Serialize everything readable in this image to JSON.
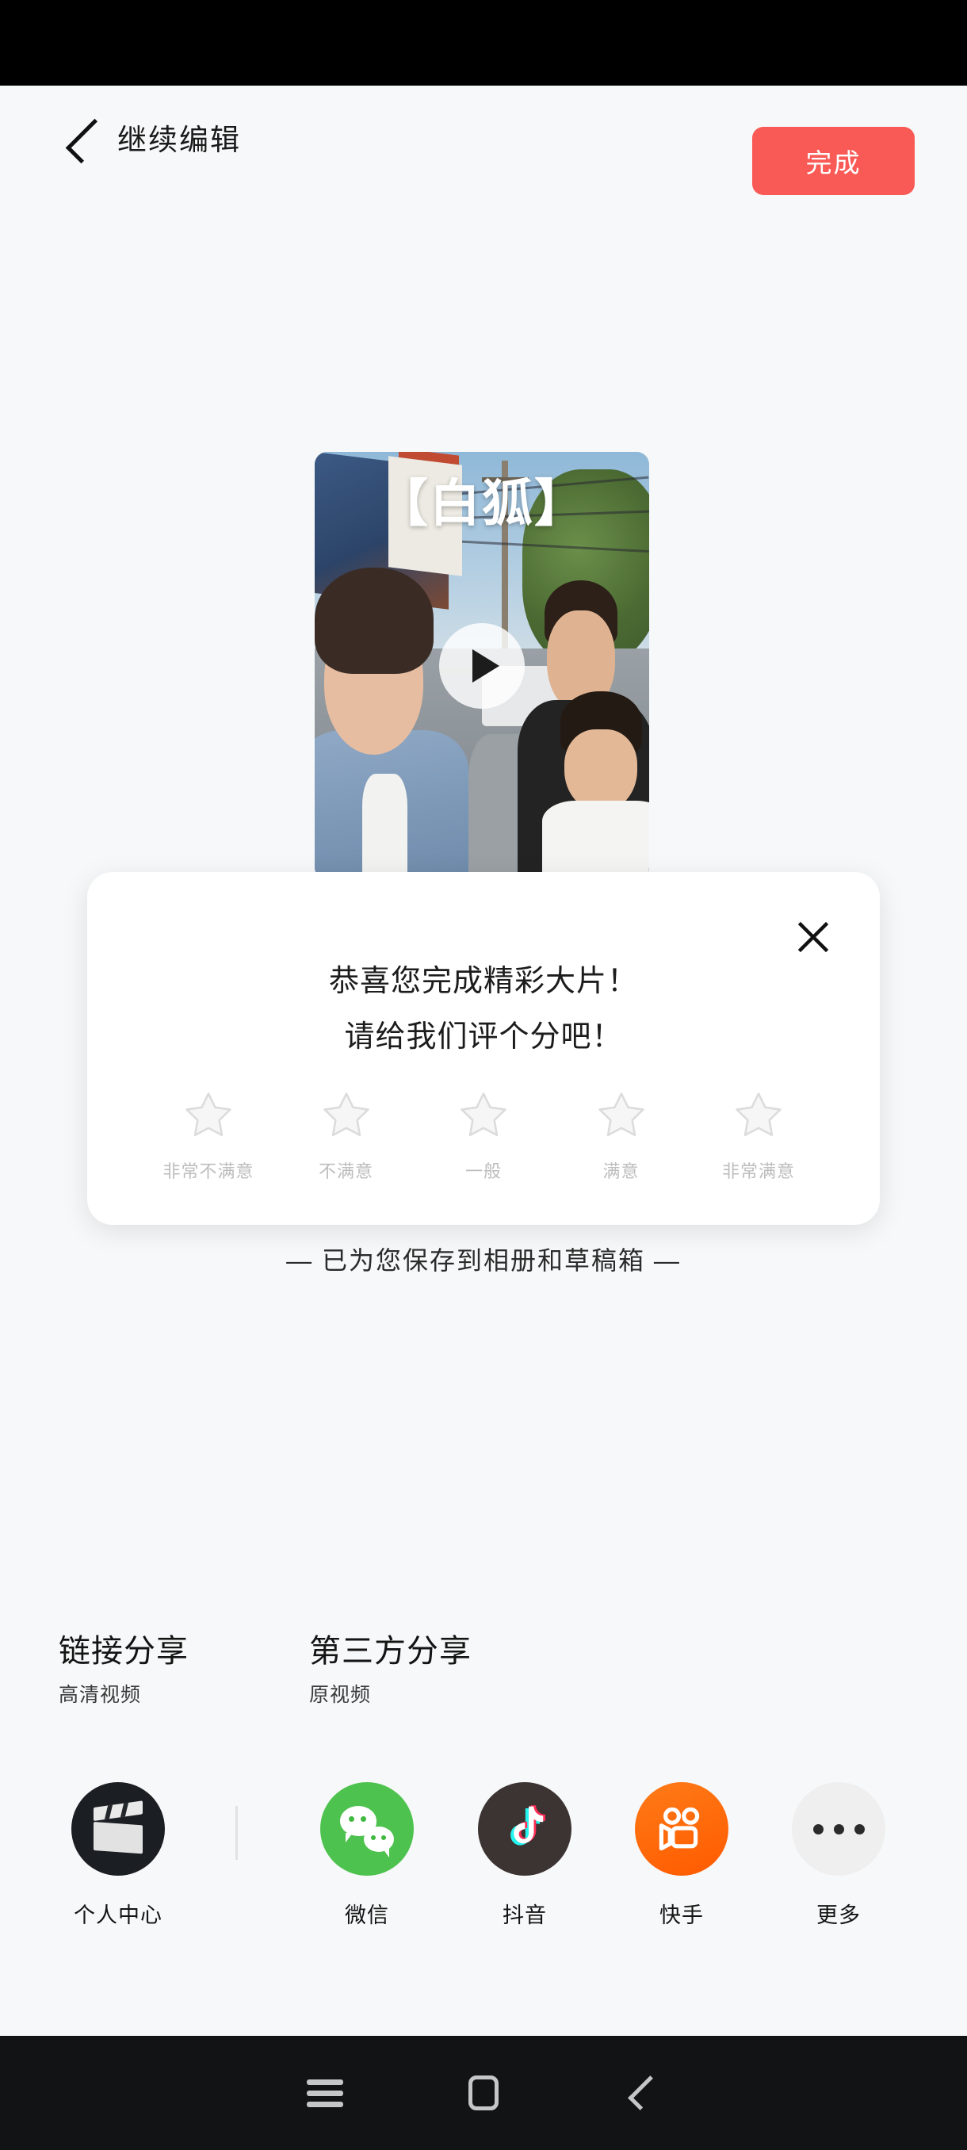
{
  "header": {
    "back_icon": "chevron-left-icon",
    "title": "继续编辑",
    "done_label": "完成",
    "accent_color": "#fa5a55"
  },
  "video_preview": {
    "overlay_text": "【白狐】",
    "play_icon": "play-icon"
  },
  "rating_dialog": {
    "close_icon": "close-icon",
    "title": "恭喜您完成精彩大片！",
    "subtitle": "请给我们评个分吧！",
    "stars": [
      {
        "icon": "star-outline-icon",
        "label": "非常不满意",
        "value": 1
      },
      {
        "icon": "star-outline-icon",
        "label": "不满意",
        "value": 2
      },
      {
        "icon": "star-outline-icon",
        "label": "一般",
        "value": 3
      },
      {
        "icon": "star-outline-icon",
        "label": "满意",
        "value": 4
      },
      {
        "icon": "star-outline-icon",
        "label": "非常满意",
        "value": 5
      }
    ],
    "selected_rating": 0
  },
  "saved_note": "— 已为您保存到相册和草稿箱 —",
  "share": {
    "link_share": {
      "title": "链接分享",
      "subtitle": "高清视频"
    },
    "third_party_share": {
      "title": "第三方分享",
      "subtitle": "原视频"
    },
    "items": [
      {
        "icon": "film-slate-icon",
        "label": "个人中心",
        "color": "#1b1e23"
      },
      {
        "icon": "wechat-icon",
        "label": "微信",
        "color": "#4ec24e"
      },
      {
        "icon": "douyin-icon",
        "label": "抖音",
        "color": "#3c3432"
      },
      {
        "icon": "kuaishou-icon",
        "label": "快手",
        "color": "#ff6a00"
      },
      {
        "icon": "more-icon",
        "label": "更多",
        "color": "#efefef"
      }
    ]
  },
  "nav_bar": {
    "recents_icon": "menu-icon",
    "home_icon": "home-square-icon",
    "back_icon": "chevron-left-icon"
  }
}
